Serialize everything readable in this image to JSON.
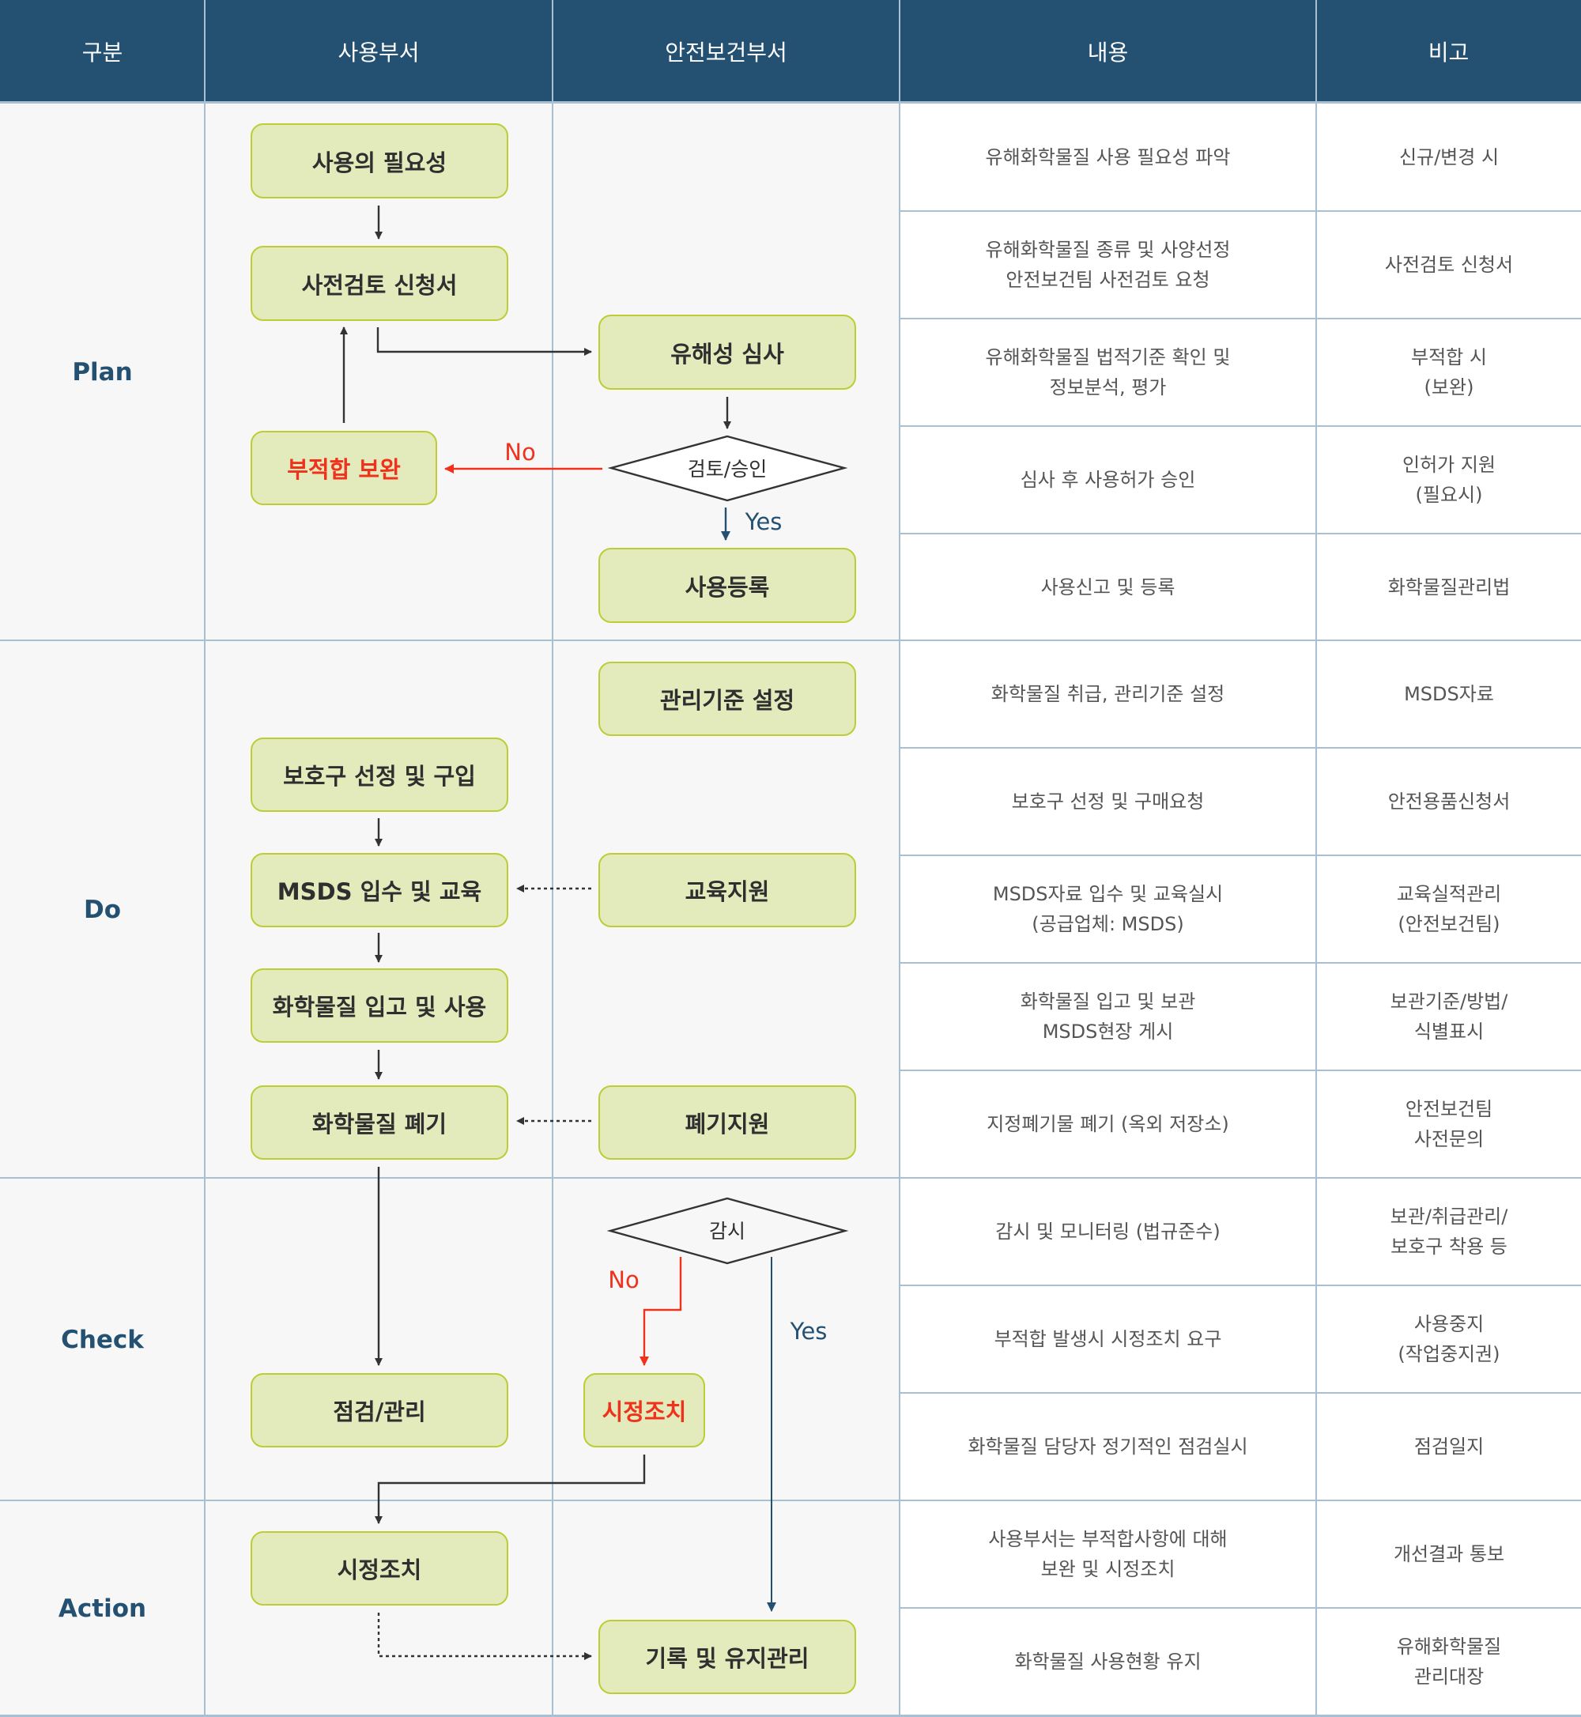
{
  "header": {
    "columns": [
      "구분",
      "사용부서",
      "안전보건부서",
      "내용",
      "비고"
    ]
  },
  "phases": [
    "Plan",
    "Do",
    "Check",
    "Action"
  ],
  "colors": {
    "header_bg": "#245172",
    "phase_text": "#245172",
    "box_fill": "#e3eabc",
    "box_border": "#bccd35",
    "no_path": "#f0321c",
    "yes_path": "#245172",
    "arrow": "#333333"
  },
  "flow": {
    "user_dept": {
      "need": "사용의 필요성",
      "pre_review_request": "사전검토 신청서",
      "nonconformity_fix": "부적합 보완",
      "ppe_purchase": "보호구 선정 및 구입",
      "msds_training": "MSDS 입수 및 교육",
      "receive_use": "화학물질 입고 및 사용",
      "disposal": "화학물질 폐기",
      "inspection": "점검/관리",
      "corrective_action": "시정조치"
    },
    "safety_dept": {
      "hazard_review": "유해성 심사",
      "review_approval": "검토/승인",
      "registration": "사용등록",
      "standards": "관리기준 설정",
      "training_support": "교육지원",
      "disposal_support": "폐기지원",
      "monitoring": "감시",
      "corrective_action": "시정조치",
      "record_keeping": "기록 및 유지관리"
    },
    "labels": {
      "no_1": "No",
      "yes_1": "Yes",
      "no_2": "No",
      "yes_2": "Yes"
    }
  },
  "rows": [
    {
      "content": "유해화학물질 사용 필요성 파악",
      "note": "신규/변경 시"
    },
    {
      "content": "유해화학물질 종류 및 사양선정\n안전보건팀 사전검토 요청",
      "note": "사전검토 신청서"
    },
    {
      "content": "유해화학물질 법적기준 확인 및\n정보분석, 평가",
      "note": "부적합 시\n(보완)"
    },
    {
      "content": "심사 후 사용허가 승인",
      "note": "인허가 지원\n(필요시)"
    },
    {
      "content": "사용신고 및 등록",
      "note": "화학물질관리법"
    },
    {
      "content": "화학물질 취급, 관리기준 설정",
      "note": "MSDS자료"
    },
    {
      "content": "보호구 선정 및 구매요청",
      "note": "안전용품신청서"
    },
    {
      "content": "MSDS자료 입수 및 교육실시\n(공급업체: MSDS)",
      "note": "교육실적관리\n(안전보건팀)"
    },
    {
      "content": "화학물질 입고 및 보관\nMSDS현장 게시",
      "note": "보관기준/방법/\n식별표시"
    },
    {
      "content": "지정폐기물 폐기 (옥외 저장소)",
      "note": "안전보건팀\n사전문의"
    },
    {
      "content": "감시 및 모니터링 (법규준수)",
      "note": "보관/취급관리/\n보호구 착용 등"
    },
    {
      "content": "부적합 발생시 시정조치 요구",
      "note": "사용중지\n(작업중지권)"
    },
    {
      "content": "화학물질 담당자 정기적인 점검실시",
      "note": "점검일지"
    },
    {
      "content": "사용부서는 부적합사항에 대해\n보완 및 시정조치",
      "note": "개선결과 통보"
    },
    {
      "content": "화학물질 사용현황 유지",
      "note": "유해화학물질\n관리대장"
    }
  ]
}
